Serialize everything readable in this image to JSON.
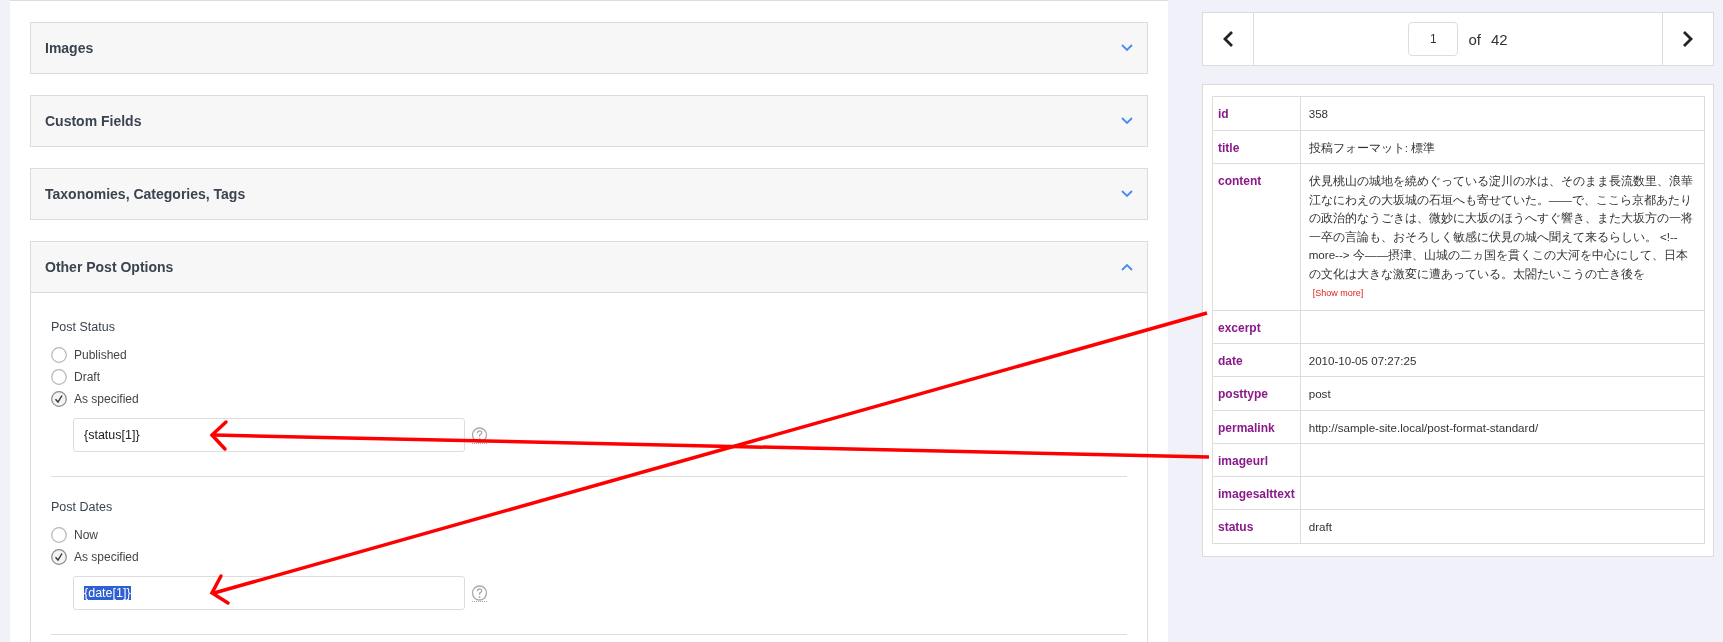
{
  "accordion": [
    {
      "title": "Images",
      "expanded": false
    },
    {
      "title": "Custom Fields",
      "expanded": false
    },
    {
      "title": "Taxonomies, Categories, Tags",
      "expanded": false
    },
    {
      "title": "Other Post Options",
      "expanded": true
    }
  ],
  "post_status": {
    "label": "Post Status",
    "options": [
      {
        "label": "Published",
        "selected": false
      },
      {
        "label": "Draft",
        "selected": false
      },
      {
        "label": "As specified",
        "selected": true
      }
    ],
    "field": {
      "value": "{status[1]}",
      "highlighted": false
    }
  },
  "post_dates": {
    "label": "Post Dates",
    "options": [
      {
        "label": "Now",
        "selected": false
      },
      {
        "label": "As specified",
        "selected": true
      }
    ],
    "field": {
      "value": "{date[1]}",
      "highlighted": true
    }
  },
  "pager": {
    "page": "1",
    "of": "of",
    "total": "42"
  },
  "record": [
    {
      "key": "id",
      "value": "358"
    },
    {
      "key": "title",
      "value": "投稿フォーマット: 標準"
    },
    {
      "key": "content",
      "value": "伏見桃山の城地を繞めぐっている淀川の水は、そのまま長流数里、浪華江なにわえの大坂城の石垣へも寄せていた。――で、ここら京都あたりの政治的なうごきは、微妙に大坂のほうへすぐ響き、また大坂方の一将一卒の言論も、おそろしく敏感に伏見の城へ聞えて来るらしい。 <!--more--> 今――摂津、山城の二ヵ国を貫くこの大河を中心にして、日本の文化は大きな激変に遭あっている。太閤たいこうの亡き後を",
      "show_more": "[Show more]"
    },
    {
      "key": "excerpt"
    },
    {
      "key": "date",
      "value": "2010-10-05 07:27:25"
    },
    {
      "key": "posttype",
      "value": "post"
    },
    {
      "key": "permalink",
      "value": "http://sample-site.local/post-format-standard/"
    },
    {
      "key": "imageurl"
    },
    {
      "key": "imagesalttext"
    },
    {
      "key": "status",
      "value": "draft"
    }
  ]
}
